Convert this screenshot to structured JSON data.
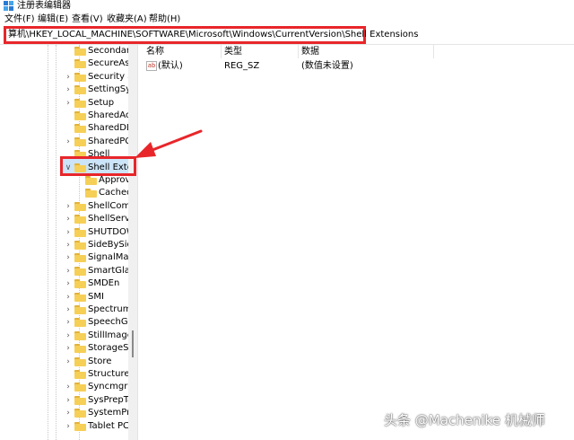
{
  "window": {
    "title": "注册表编辑器"
  },
  "menu": [
    "文件(F)",
    "编辑(E)",
    "查看(V)",
    "收藏夹(A)",
    "帮助(H)"
  ],
  "address": {
    "path": "算机\\HKEY_LOCAL_MACHINE\\SOFTWARE\\Microsoft\\Windows\\CurrentVersion\\Shell Extensions"
  },
  "tree": {
    "items": [
      {
        "label": "Secondary",
        "expandable": false
      },
      {
        "label": "SecureAss",
        "expandable": false
      },
      {
        "label": "Security ar",
        "expandable": true
      },
      {
        "label": "SettingSyn",
        "expandable": true
      },
      {
        "label": "Setup",
        "expandable": true
      },
      {
        "label": "SharedAcc",
        "expandable": false
      },
      {
        "label": "SharedDLL",
        "expandable": false
      },
      {
        "label": "SharedPC",
        "expandable": true
      },
      {
        "label": "Shell",
        "expandable": false
      },
      {
        "label": "Shell Exter",
        "expandable": true,
        "expanded": true,
        "selected": true
      },
      {
        "label": "Approv",
        "expandable": false,
        "child": true
      },
      {
        "label": "Cached",
        "expandable": false,
        "child": true
      },
      {
        "label": "ShellComp",
        "expandable": true
      },
      {
        "label": "ShellServic",
        "expandable": true
      },
      {
        "label": "SHUTDOW",
        "expandable": true
      },
      {
        "label": "SideBySide",
        "expandable": true
      },
      {
        "label": "SignalMar",
        "expandable": true
      },
      {
        "label": "SmartGlas",
        "expandable": true
      },
      {
        "label": "SMDEn",
        "expandable": true
      },
      {
        "label": "SMI",
        "expandable": true
      },
      {
        "label": "Spectrum",
        "expandable": true
      },
      {
        "label": "SpeechGe",
        "expandable": true
      },
      {
        "label": "StillImage",
        "expandable": true
      },
      {
        "label": "StorageSe",
        "expandable": true
      },
      {
        "label": "Store",
        "expandable": true
      },
      {
        "label": "Structured",
        "expandable": false
      },
      {
        "label": "Syncmgr",
        "expandable": true
      },
      {
        "label": "SysPrepTa",
        "expandable": true
      },
      {
        "label": "SystemPro",
        "expandable": true
      },
      {
        "label": "Tablet PC",
        "expandable": true
      }
    ]
  },
  "values": {
    "columns": [
      "名称",
      "类型",
      "数据"
    ],
    "rows": [
      {
        "icon": "ab",
        "name": "(默认)",
        "type": "REG_SZ",
        "data": "(数值未设置)"
      }
    ]
  },
  "colors": {
    "highlight": "#e8262a",
    "folder": "#f6cf57",
    "selection": "#cce4f7"
  },
  "watermark": "头条 @Machenike 机械师"
}
